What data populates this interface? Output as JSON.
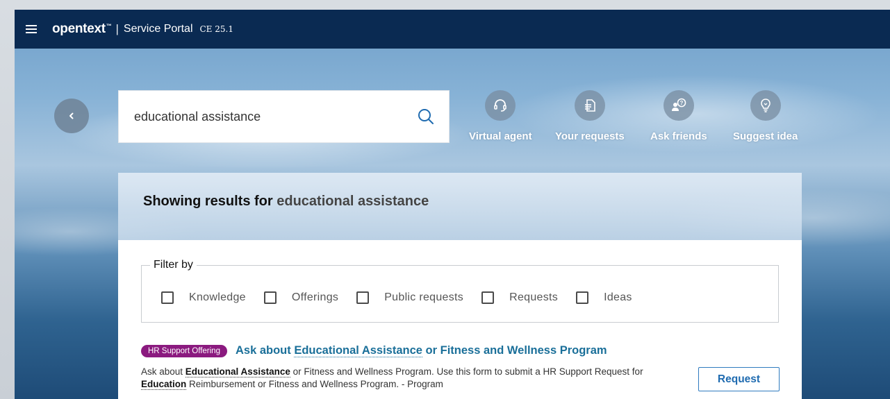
{
  "topbar": {
    "brand": "opentext",
    "brand_tm": "™",
    "separator": "|",
    "portal_title": "Service Portal",
    "version": "CE 25.1"
  },
  "search": {
    "value": "educational assistance"
  },
  "quick_actions": [
    {
      "label": "Virtual agent",
      "icon": "headset-icon"
    },
    {
      "label": "Your requests",
      "icon": "document-icon"
    },
    {
      "label": "Ask friends",
      "icon": "ask-friends-icon"
    },
    {
      "label": "Suggest idea",
      "icon": "lightbulb-icon"
    }
  ],
  "results": {
    "heading_prefix": "Showing results for",
    "heading_query": "educational assistance"
  },
  "filter": {
    "legend": "Filter by",
    "options": [
      "Knowledge",
      "Offerings",
      "Public requests",
      "Requests",
      "Ideas"
    ]
  },
  "result_item": {
    "badge": "HR Support Offering",
    "title_pre": "Ask about ",
    "title_hl": "Educational Assistance",
    "title_post": " or Fitness and Wellness Program",
    "desc_1": "Ask about ",
    "desc_hl1": "Educational Assistance",
    "desc_2": " or Fitness and Wellness Program. Use this form to submit a HR Support Request for ",
    "desc_hl2": "Education",
    "desc_3": " Reimbursement or Fitness and Wellness Program. - Program",
    "button_label": "Request"
  },
  "colors": {
    "topbar": "#0a2a52",
    "badge": "#8b1a7f",
    "link": "#1a6f99",
    "button": "#1f6bb0"
  }
}
